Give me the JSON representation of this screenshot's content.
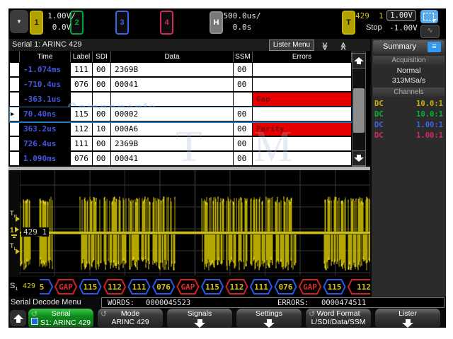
{
  "top_bar": {
    "menu_button_glyph": "▼",
    "channels": [
      {
        "num": "1",
        "color": "#c8b400",
        "filled": true,
        "scale": "1.00V/",
        "offset": "0.0V"
      },
      {
        "num": "2",
        "color": "#00a83c",
        "filled": false
      },
      {
        "num": "3",
        "color": "#3c64e6",
        "filled": false
      },
      {
        "num": "4",
        "color": "#d42864",
        "filled": false
      }
    ],
    "horizontal": {
      "label": "H",
      "scale": "500.0us/",
      "delay": "0.0s"
    },
    "trigger": {
      "label": "T",
      "source": "429",
      "channel": "1",
      "level_high": "1.00V",
      "status": "Stop",
      "level_low": "-1.00V"
    }
  },
  "lister": {
    "title": "Serial 1: ARINC 429",
    "menu_button": "Lister Menu",
    "columns": [
      "Time",
      "Label",
      "SDI",
      "Data",
      "SSM",
      "Errors"
    ],
    "marker_glyph": "▶",
    "rows": [
      {
        "time": "-1.074ms",
        "label": "111",
        "sdi": "00",
        "data": "2369B",
        "ssm": "00",
        "error": "",
        "selected": false
      },
      {
        "time": "-710.4us",
        "label": "076",
        "sdi": "00",
        "data": "00041",
        "ssm": "00",
        "error": "",
        "selected": false
      },
      {
        "time": "-363.1us",
        "label": "",
        "sdi": "",
        "data": "",
        "ssm": "",
        "error": "Gap",
        "selected": false
      },
      {
        "time": "70.40ns",
        "label": "115",
        "sdi": "00",
        "data": "00002",
        "ssm": "00",
        "error": "",
        "selected": true
      },
      {
        "time": "363.2us",
        "label": "112",
        "sdi": "10",
        "data": "000A6",
        "ssm": "00",
        "error": "Parity",
        "selected": false
      },
      {
        "time": "726.4us",
        "label": "111",
        "sdi": "00",
        "data": "2369B",
        "ssm": "00",
        "error": "",
        "selected": false
      },
      {
        "time": "1.090ms",
        "label": "076",
        "sdi": "00",
        "data": "00041",
        "ssm": "00",
        "error": "",
        "selected": false
      }
    ]
  },
  "sidebar": {
    "title": "Summary",
    "acquisition": {
      "header": "Acquisition",
      "mode": "Normal",
      "sample_rate": "313MSa/s"
    },
    "channels": {
      "header": "Channels",
      "rows": [
        {
          "coupling": "DC",
          "ratio": "10.0:1",
          "color": "#c8b400"
        },
        {
          "coupling": "DC",
          "ratio": "10.0:1",
          "color": "#00b43c"
        },
        {
          "coupling": "DC",
          "ratio": "1.00:1",
          "color": "#3c64e6"
        },
        {
          "coupling": "DC",
          "ratio": "1.00:1",
          "color": "#d42864"
        }
      ]
    }
  },
  "waveform": {
    "bus_label": "429_1",
    "threshold_high_label": "TH",
    "threshold_low_label": "TL",
    "ground_channel": "1"
  },
  "decode": {
    "bus_id": "S1",
    "bus_name": "429",
    "frames": [
      {
        "text": "5",
        "error": false,
        "partial": "left"
      },
      {
        "text": "GAP",
        "error": true,
        "partial": ""
      },
      {
        "text": "115",
        "error": false,
        "partial": ""
      },
      {
        "text": "112",
        "error": true,
        "partial": ""
      },
      {
        "text": "111",
        "error": false,
        "partial": ""
      },
      {
        "text": "076",
        "error": false,
        "partial": ""
      },
      {
        "text": "GAP",
        "error": true,
        "partial": ""
      },
      {
        "text": "115",
        "error": false,
        "partial": ""
      },
      {
        "text": "112",
        "error": true,
        "partial": ""
      },
      {
        "text": "111",
        "error": false,
        "partial": ""
      },
      {
        "text": "076",
        "error": false,
        "partial": ""
      },
      {
        "text": "GAP",
        "error": true,
        "partial": ""
      },
      {
        "text": "115",
        "error": false,
        "partial": ""
      },
      {
        "text": "112",
        "error": true,
        "partial": "right"
      }
    ]
  },
  "status": {
    "menu_title": "Serial Decode Menu",
    "words_label": "WORDS:",
    "words_count": "0000045523",
    "errors_label": "ERRORS:",
    "errors_count": "0000474511"
  },
  "softkeys": [
    {
      "line1": "Serial",
      "line2": "S1: ARINC 429",
      "green": true,
      "icon": "cycle",
      "checkbox": true,
      "arrow": false
    },
    {
      "line1": "Mode",
      "line2": "ARINC 429",
      "green": false,
      "icon": "cycle",
      "checkbox": false,
      "arrow": false
    },
    {
      "line1": "Signals",
      "line2": "",
      "green": false,
      "icon": "",
      "checkbox": false,
      "arrow": true
    },
    {
      "line1": "Settings",
      "line2": "",
      "green": false,
      "icon": "",
      "checkbox": false,
      "arrow": true
    },
    {
      "line1": "Word Format",
      "line2": "L/SDI/Data/SSM",
      "green": false,
      "icon": "cycle",
      "checkbox": false,
      "arrow": false
    },
    {
      "line1": "Lister",
      "line2": "",
      "green": false,
      "icon": "",
      "checkbox": false,
      "arrow": true
    }
  ],
  "watermark": {
    "word": "Components",
    "big_left": "T",
    "big_right": "M"
  },
  "colors": {
    "accent_yellow": "#c8b400",
    "error_red": "#e60000",
    "select_blue": "#2878b8",
    "hex_blue": "#2858e8",
    "hex_red": "#d42020",
    "time_blue": "#4456e0",
    "trigger_orange": "#e8a030"
  }
}
